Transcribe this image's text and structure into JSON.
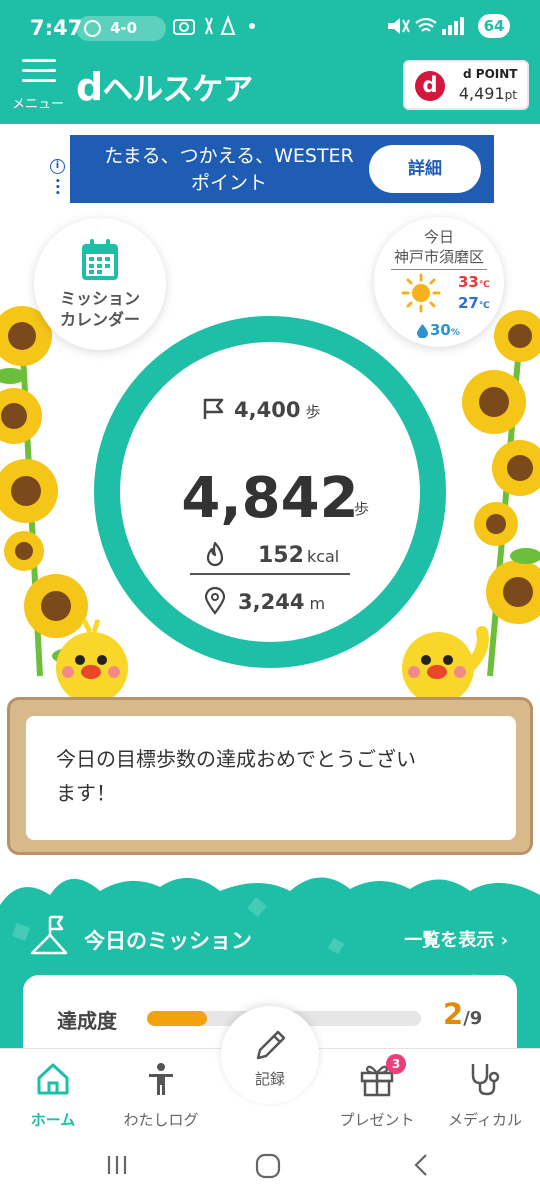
{
  "status_bar": {
    "time": "7:47",
    "score": "4-0",
    "battery": "64",
    "icons": [
      "baseball-icon",
      "game-icon",
      "kanji-icon",
      "camera-icon",
      "dot-icon",
      "mute-icon",
      "wifi-icon",
      "signal-icon",
      "battery-icon"
    ]
  },
  "header": {
    "menu_label": "メニュー",
    "app_title": "ヘルスケア",
    "app_title_d": "d",
    "dpoint": {
      "logo": "d",
      "label": "POINT",
      "label_d": "d",
      "amount": "4,491",
      "unit": "pt"
    }
  },
  "ad": {
    "text_line1": "たまる、つかえる、WESTER",
    "text_line2": "ポイント",
    "button": "詳細",
    "info": "i"
  },
  "mission_calendar": {
    "label_line1": "ミッション",
    "label_line2": "カレンダー"
  },
  "weather": {
    "today": "今日",
    "city": "神戸市須磨区",
    "high": "33",
    "low": "27",
    "temp_unit": "℃",
    "rain": "30",
    "rain_unit": "%"
  },
  "steps": {
    "goal": "4,400",
    "goal_unit": "歩",
    "current": "4,842",
    "unit": "歩",
    "kcal": "152",
    "kcal_unit": "kcal",
    "distance": "3,244",
    "distance_unit": "m",
    "progress_fraction": 1.0
  },
  "message": {
    "text": "今日の目標歩数の達成おめでとうござい\nます！"
  },
  "mission": {
    "title": "今日のミッション",
    "view_all": "一覧を表示",
    "achievement_label": "達成度",
    "achieved": "2",
    "total": "/9",
    "progress_fraction": 0.22
  },
  "nav": {
    "home": "ホーム",
    "my_log": "わたしログ",
    "record": "記録",
    "present": "プレゼント",
    "present_badge": "3",
    "medical": "メディカル"
  },
  "colors": {
    "teal": "#1ebfa6",
    "accent_orange": "#f2a20c",
    "dpoint_red": "#d4173f",
    "ad_blue": "#1f5db5"
  }
}
